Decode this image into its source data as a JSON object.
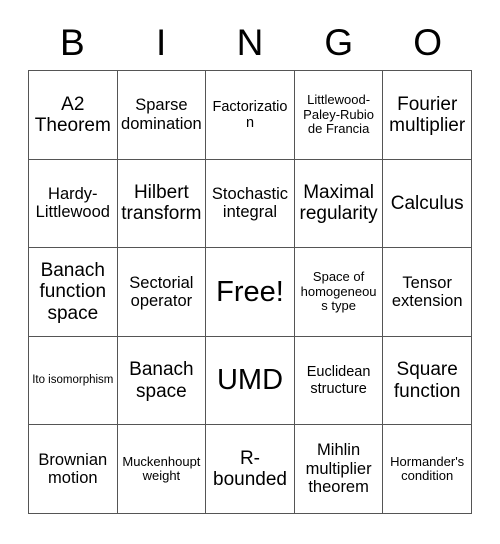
{
  "card": {
    "title": "BINGO",
    "header_letters": [
      "B",
      "I",
      "N",
      "G",
      "O"
    ],
    "grid_size": "5x5",
    "free_space_index": 12,
    "colors": {
      "background": "#ffffff",
      "text": "#000000",
      "grid_line": "#555555"
    },
    "cells": [
      {
        "label": "A2 Theorem",
        "size": "l"
      },
      {
        "label": "Sparse domination",
        "size": "m"
      },
      {
        "label": "Factorization",
        "size": "s"
      },
      {
        "label": "Littlewood-Paley-Rubio de Francia",
        "size": "xs"
      },
      {
        "label": "Fourier multiplier",
        "size": "l"
      },
      {
        "label": "Hardy-Littlewood",
        "size": "m"
      },
      {
        "label": "Hilbert transform",
        "size": "l"
      },
      {
        "label": "Stochastic integral",
        "size": "m"
      },
      {
        "label": "Maximal regularity",
        "size": "l"
      },
      {
        "label": "Calculus",
        "size": "l"
      },
      {
        "label": "Banach function space",
        "size": "l"
      },
      {
        "label": "Sectorial operator",
        "size": "m"
      },
      {
        "label": "Free!",
        "size": "xl"
      },
      {
        "label": "Space of homogeneous type",
        "size": "xs"
      },
      {
        "label": "Tensor extension",
        "size": "m"
      },
      {
        "label": "Ito isomorphism",
        "size": "xxs"
      },
      {
        "label": "Banach space",
        "size": "l"
      },
      {
        "label": "UMD",
        "size": "xl"
      },
      {
        "label": "Euclidean structure",
        "size": "s"
      },
      {
        "label": "Square function",
        "size": "l"
      },
      {
        "label": "Brownian motion",
        "size": "m"
      },
      {
        "label": "Muckenhoupt weight",
        "size": "xs"
      },
      {
        "label": "R-bounded",
        "size": "l"
      },
      {
        "label": "Mihlin multiplier theorem",
        "size": "m"
      },
      {
        "label": "Hormander's condition",
        "size": "xs"
      }
    ]
  }
}
